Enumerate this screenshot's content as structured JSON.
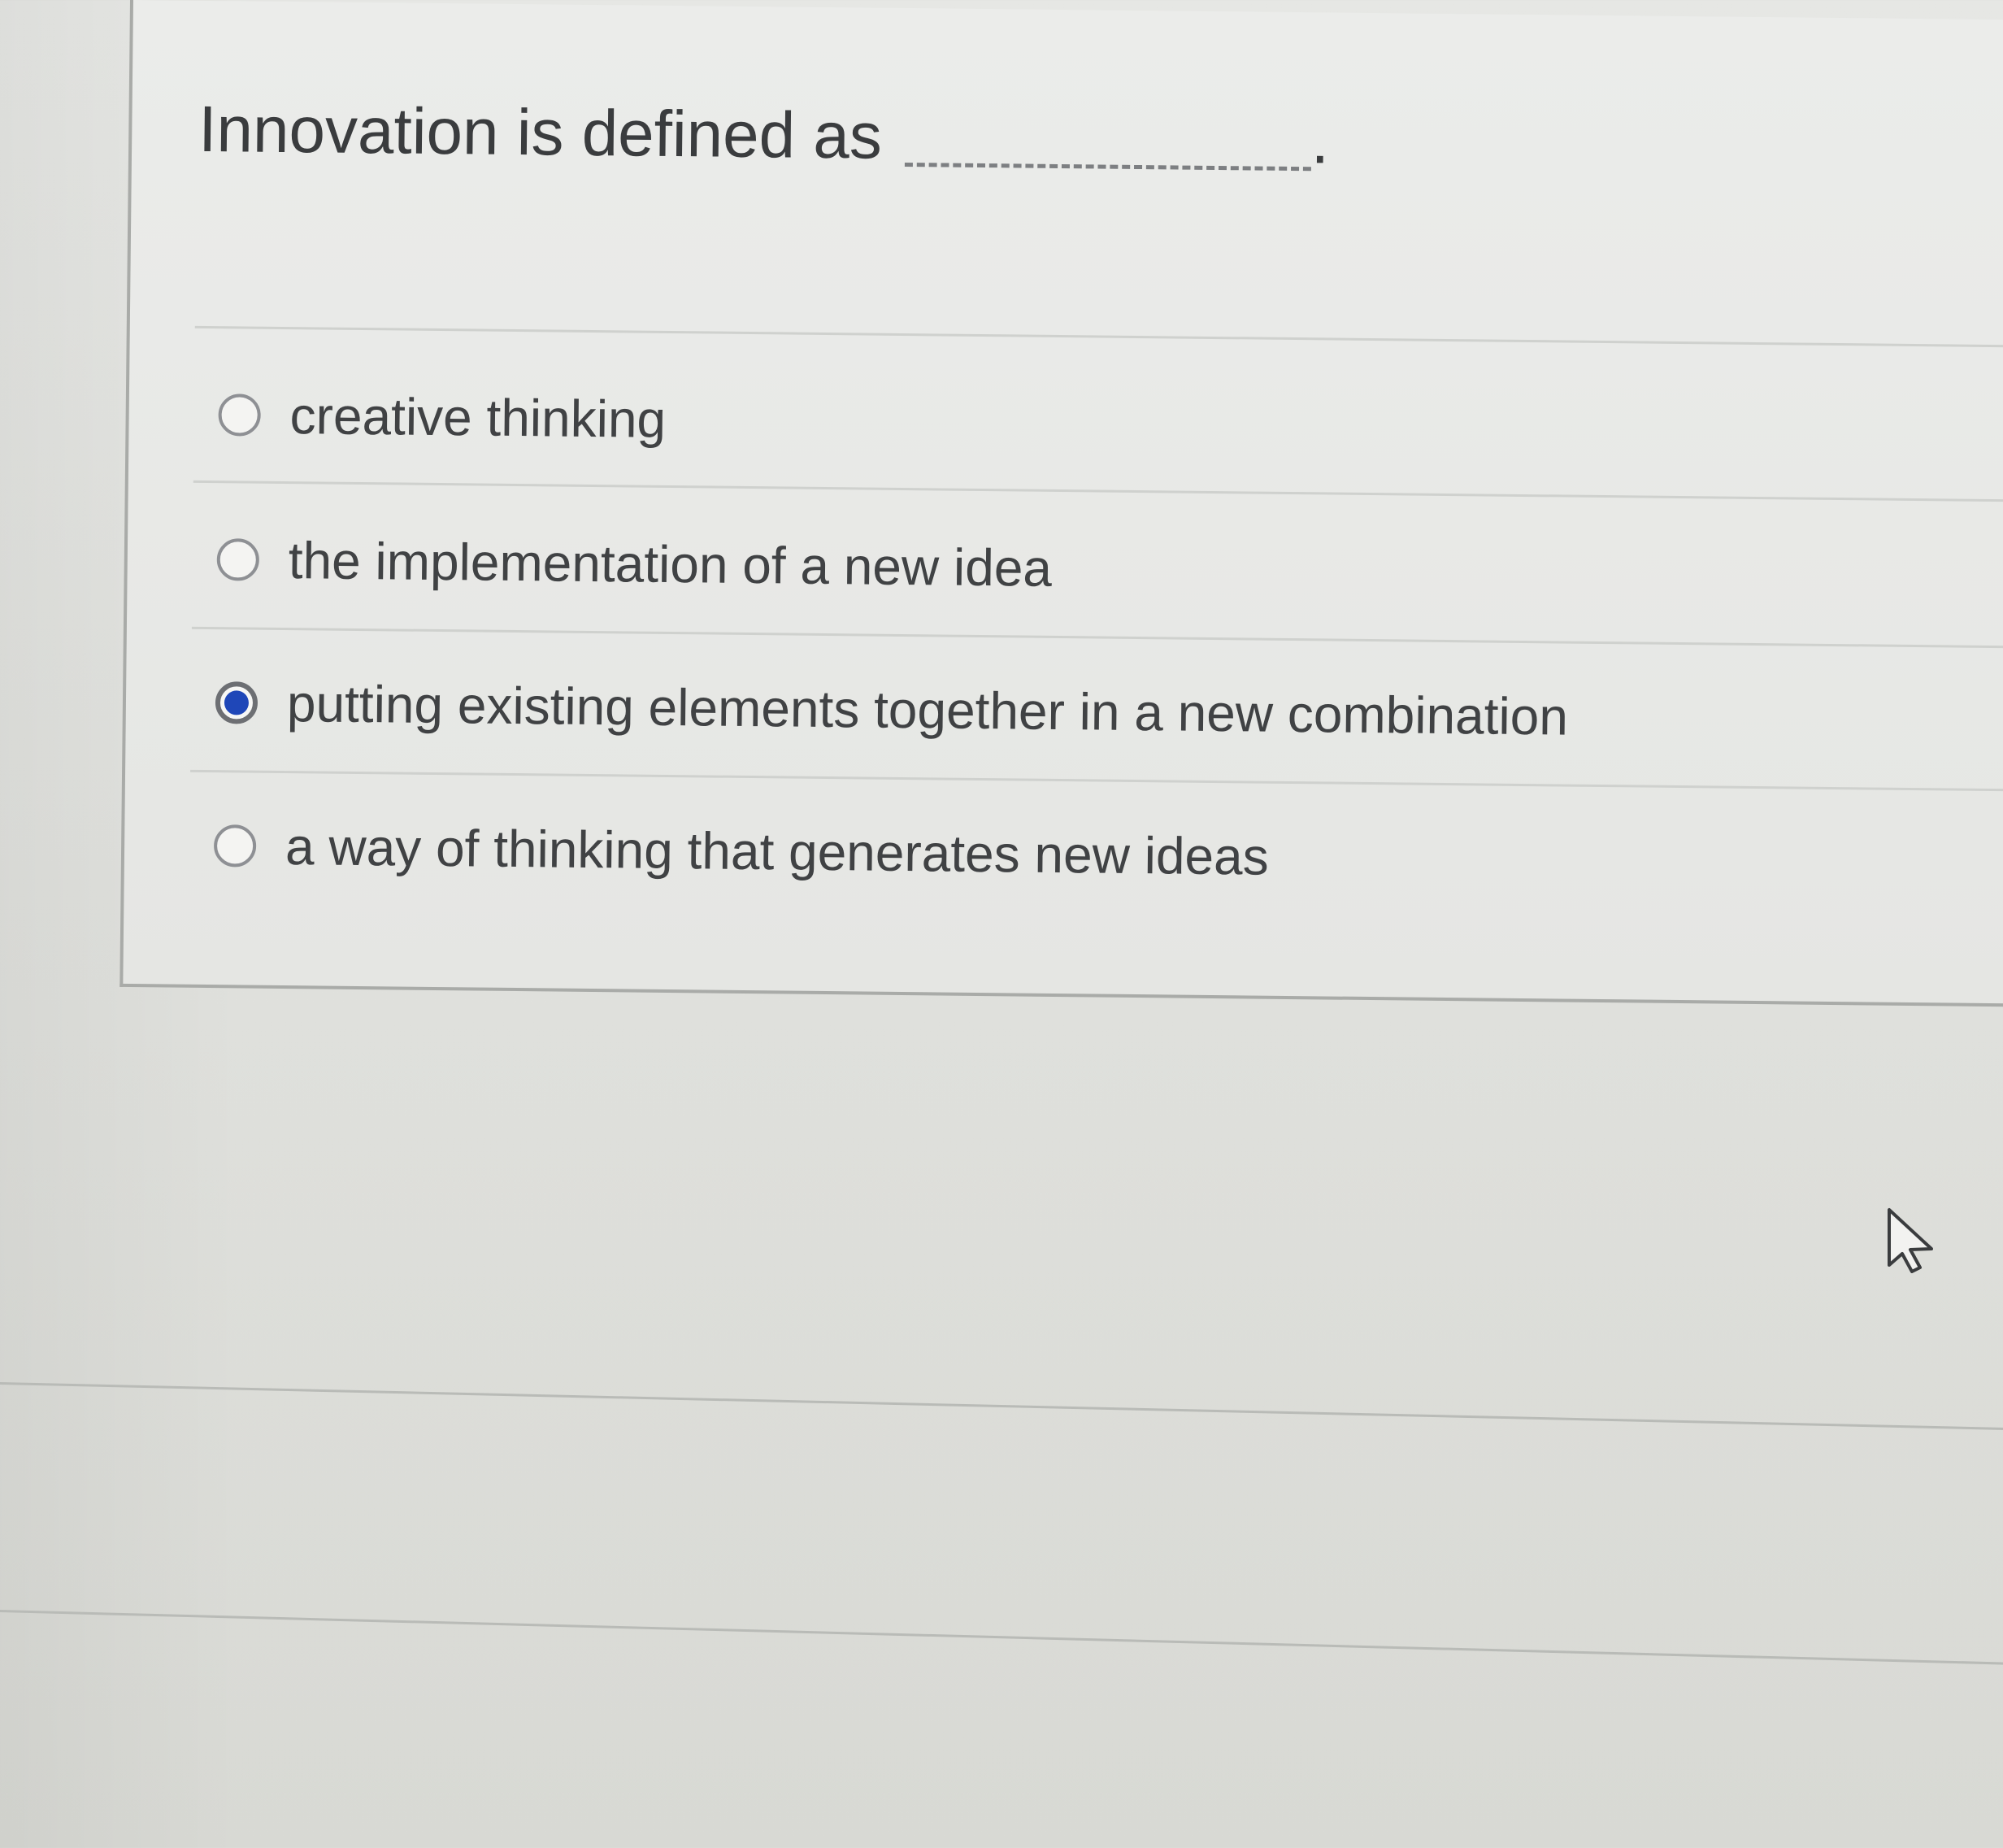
{
  "question": {
    "text": "Innovation is defined as",
    "blank_end": "."
  },
  "options": [
    {
      "label": "creative thinking",
      "selected": false
    },
    {
      "label": "the implementation of a new idea",
      "selected": false
    },
    {
      "label": "putting existing elements together in a new combination",
      "selected": true
    },
    {
      "label": "a way of thinking that generates new ideas",
      "selected": false
    }
  ],
  "colors": {
    "selected_radio": "#1f47b8",
    "text": "#3d3f41",
    "background": "#e3e4e1"
  },
  "icons": {
    "cursor": "mouse-pointer-icon"
  }
}
